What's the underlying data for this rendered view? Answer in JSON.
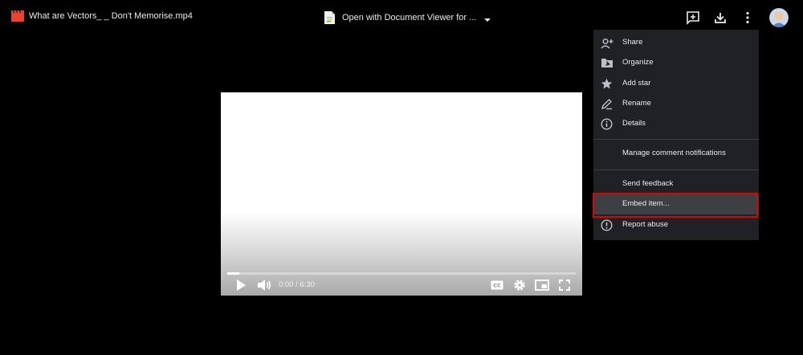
{
  "file": {
    "title": "What are Vectors_ _ Don't Memorise.mp4",
    "icon": "video-file-icon",
    "icon_color": "#ea4335"
  },
  "open_with": {
    "label": "Open with Document Viewer for ...",
    "icon": "document-viewer-icon"
  },
  "toolbar": {
    "icons": [
      "add-comment-icon",
      "download-icon",
      "more-vert-icon",
      "account-avatar"
    ]
  },
  "player": {
    "time": "0:00 / 6:30",
    "progress_fraction": 0.035,
    "controls": [
      "play-icon",
      "volume-icon",
      "captions-icon",
      "settings-icon",
      "miniplayer-icon",
      "fullscreen-icon"
    ]
  },
  "menu": {
    "items": [
      {
        "label": "Share",
        "icon": "person-add-icon"
      },
      {
        "label": "Organize",
        "icon": "folder-move-icon"
      },
      {
        "label": "Add star",
        "icon": "star-icon"
      },
      {
        "label": "Rename",
        "icon": "pencil-icon"
      },
      {
        "label": "Details",
        "icon": "info-icon"
      },
      {
        "label": "Manage comment notifications",
        "icon": ""
      },
      {
        "label": "Send feedback",
        "icon": ""
      },
      {
        "label": "Embed item...",
        "icon": "",
        "highlighted": true
      },
      {
        "label": "Report abuse",
        "icon": "report-icon"
      }
    ]
  },
  "colors": {
    "background": "#000000",
    "menu_background": "#202124",
    "menu_highlight": "#3c4043",
    "annotation_box": "#e00000"
  }
}
